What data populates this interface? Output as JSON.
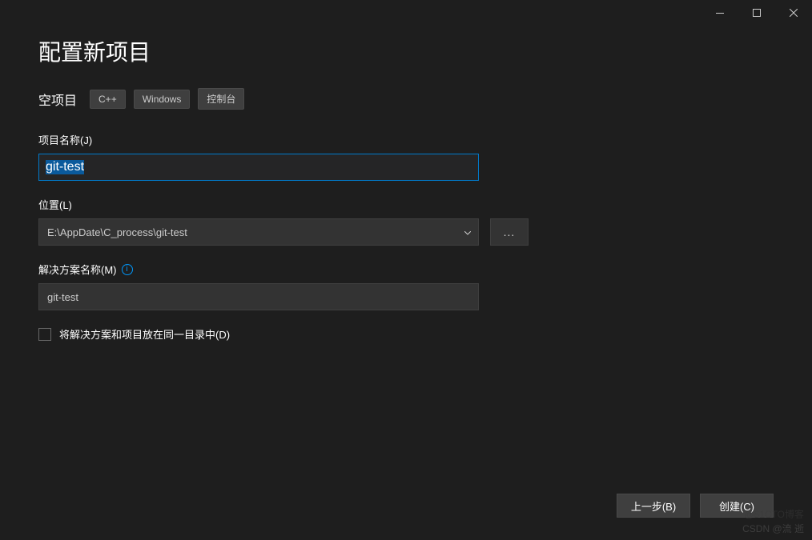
{
  "header": {
    "title": "配置新项目"
  },
  "template": {
    "name": "空项目",
    "tags": [
      "C++",
      "Windows",
      "控制台"
    ]
  },
  "fields": {
    "projectName": {
      "label": "项目名称(J)",
      "value": "git-test"
    },
    "location": {
      "label": "位置(L)",
      "value": "E:\\AppDate\\C_process\\git-test",
      "browse": "..."
    },
    "solutionName": {
      "label": "解决方案名称(M)",
      "value": "git-test"
    },
    "sameDir": {
      "label": "将解决方案和项目放在同一目录中(D)",
      "checked": false
    }
  },
  "footer": {
    "back": "上一步(B)",
    "create": "创建(C)"
  },
  "watermark": "CSDN @流 逝",
  "watermark2": "@51CTO博客"
}
